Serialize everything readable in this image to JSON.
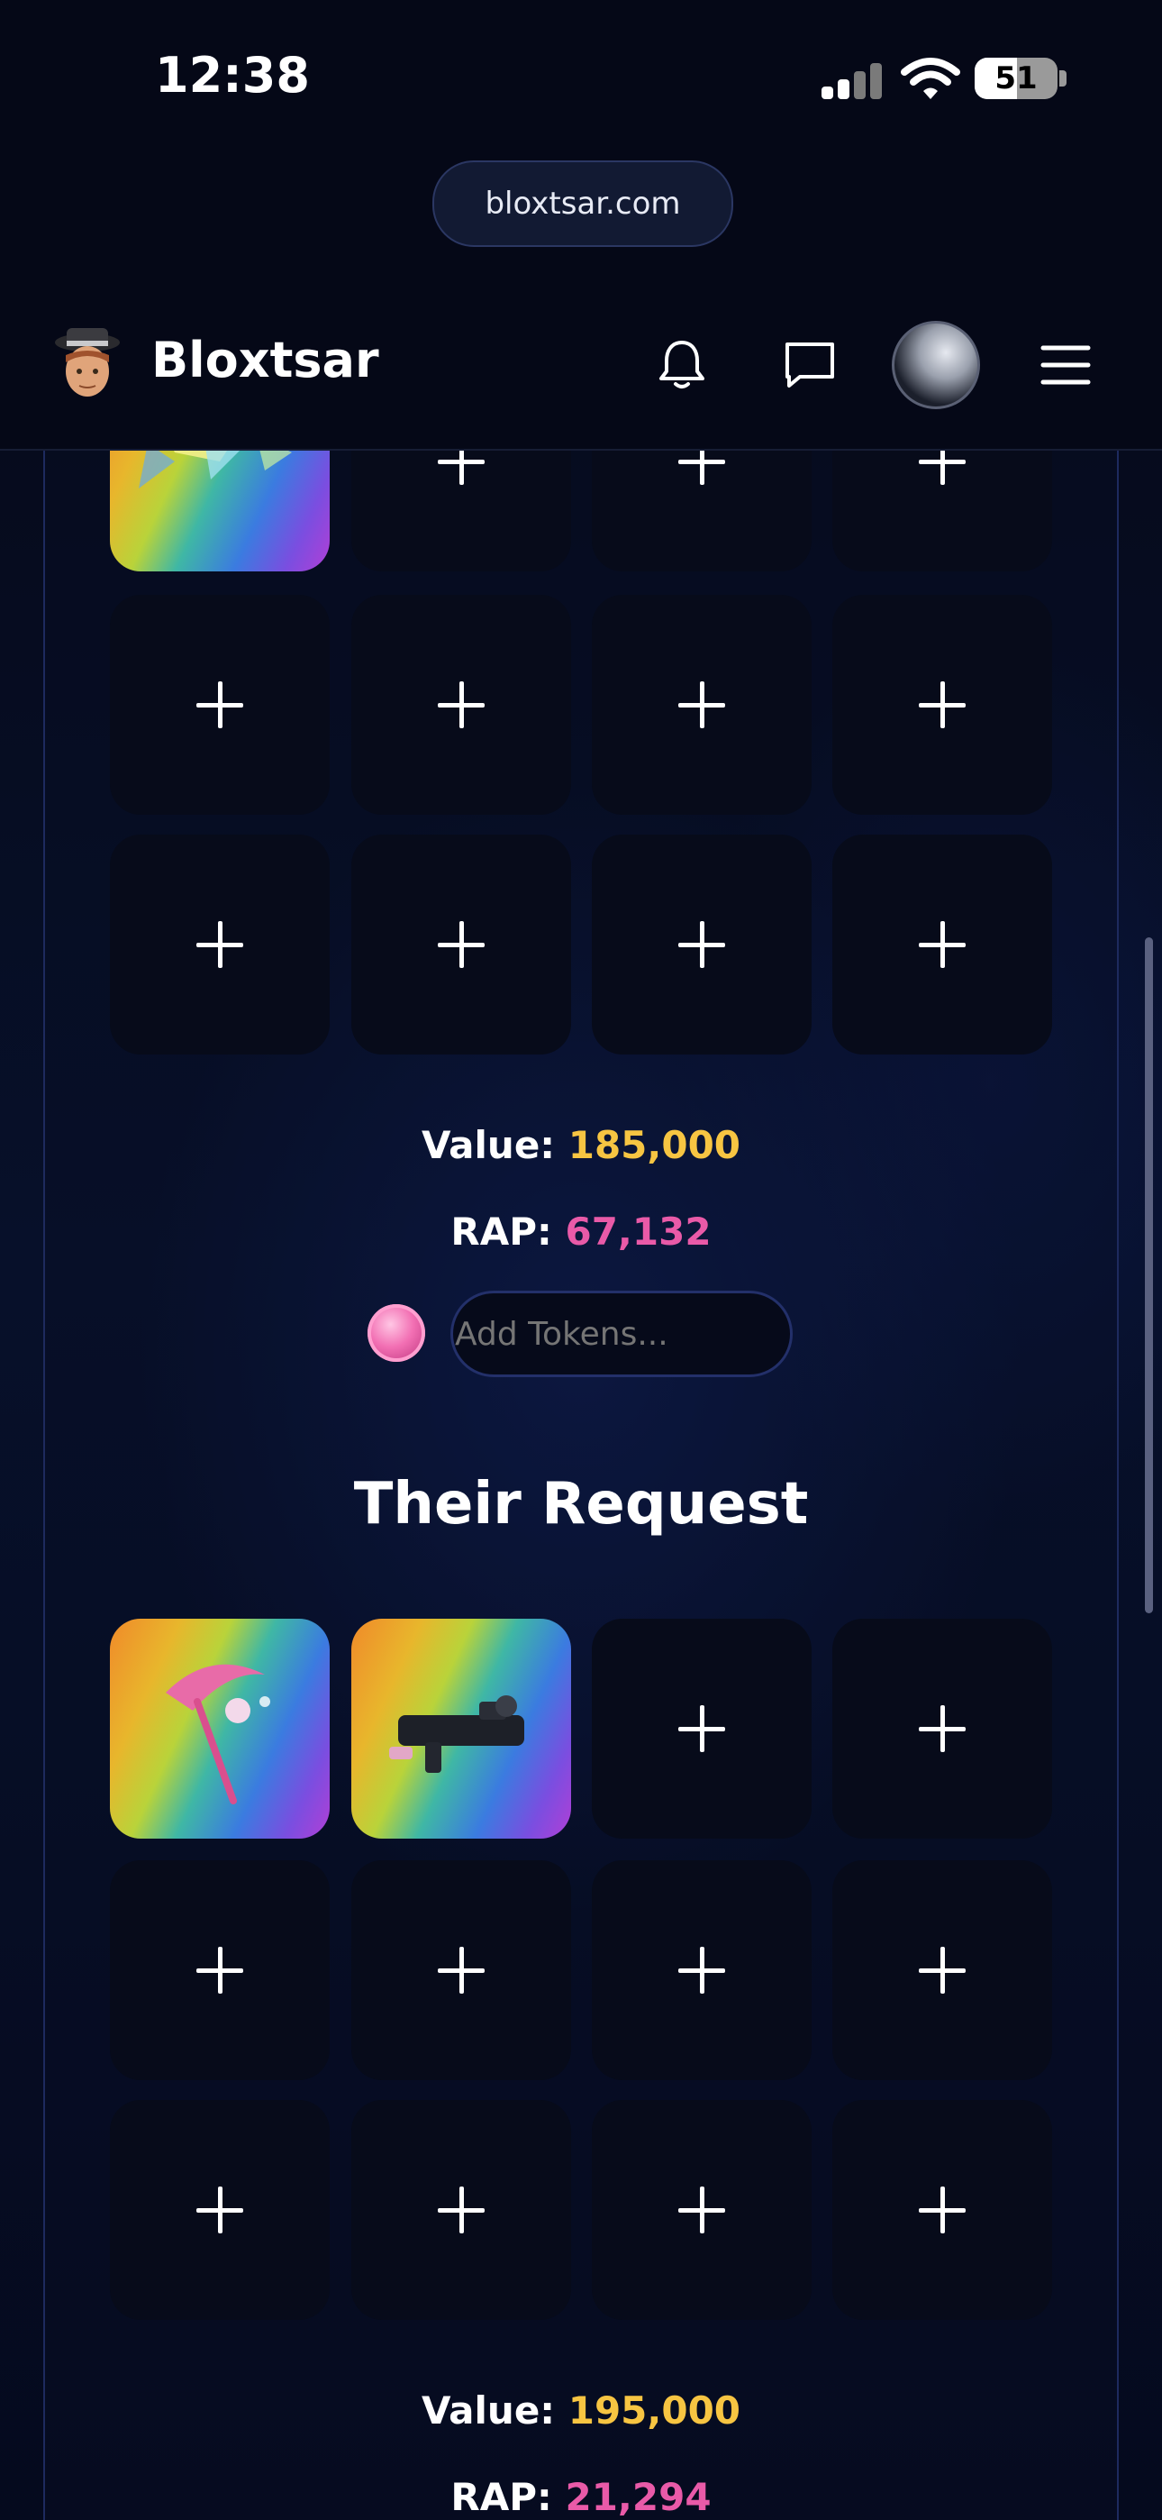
{
  "status_bar": {
    "time": "12:38",
    "battery": "51"
  },
  "browser": {
    "url": "bloxtsar.com"
  },
  "header": {
    "brand": "Bloxtsar",
    "icons": [
      "bell-icon",
      "chat-icon",
      "profile-avatar",
      "menu-icon"
    ]
  },
  "your_offer": {
    "value_label": "Value:",
    "value": "185,000",
    "rap_label": "RAP:",
    "rap": "67,132",
    "tokens_placeholder": "Add Tokens..."
  },
  "their_request": {
    "title": "Their Request",
    "value_label": "Value:",
    "value": "195,000",
    "rap_label": "RAP:",
    "rap": "21,294"
  },
  "colors": {
    "value": "#f7c542",
    "rap": "#e95aa8",
    "background": "#060a1c"
  }
}
